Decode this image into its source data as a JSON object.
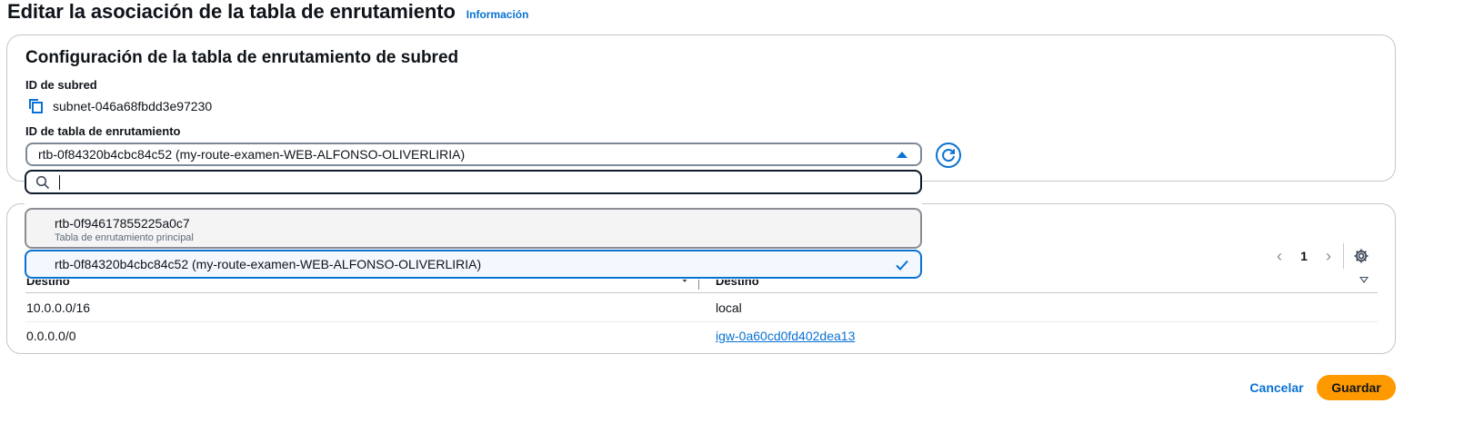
{
  "header": {
    "title": "Editar la asociación de la tabla de enrutamiento",
    "info_link": "Información"
  },
  "config": {
    "section_title": "Configuración de la tabla de enrutamiento de subred",
    "subnet_label": "ID de subred",
    "subnet_id": "subnet-046a68fbdd3e97230",
    "route_table_label": "ID de tabla de enrutamiento",
    "selected_route_table": "rtb-0f84320b4cbc84c52 (my-route-examen-WEB-ALFONSO-OLIVERLIRIA)"
  },
  "dropdown": {
    "search_value": "",
    "options": [
      {
        "label": "rtb-0f94617855225a0c7",
        "description": "Tabla de enrutamiento principal",
        "selected": false
      },
      {
        "label": "rtb-0f84320b4cbc84c52 (my-route-examen-WEB-ALFONSO-OLIVERLIRIA)",
        "description": "",
        "selected": true
      }
    ]
  },
  "routes": {
    "pagination": {
      "prev": "‹",
      "page": "1",
      "next": "›"
    },
    "columns": [
      "Destino",
      "Destino"
    ],
    "rows": [
      [
        "10.0.0.0/16",
        "local"
      ],
      [
        "0.0.0.0/0",
        "igw-0a60cd0fd402dea13"
      ]
    ]
  },
  "footer": {
    "cancel_label": "Cancelar",
    "save_label": "Guardar"
  },
  "icons": {
    "copy": "copy-icon",
    "caret": "caret-up-icon",
    "refresh": "refresh-icon",
    "search": "search-icon",
    "check": "check-icon",
    "gear": "gear-icon",
    "sort": "sort-caret-icon"
  },
  "colors": {
    "accent": "#0972d3",
    "primary_button": "#ff9900",
    "text": "#0f141a"
  }
}
